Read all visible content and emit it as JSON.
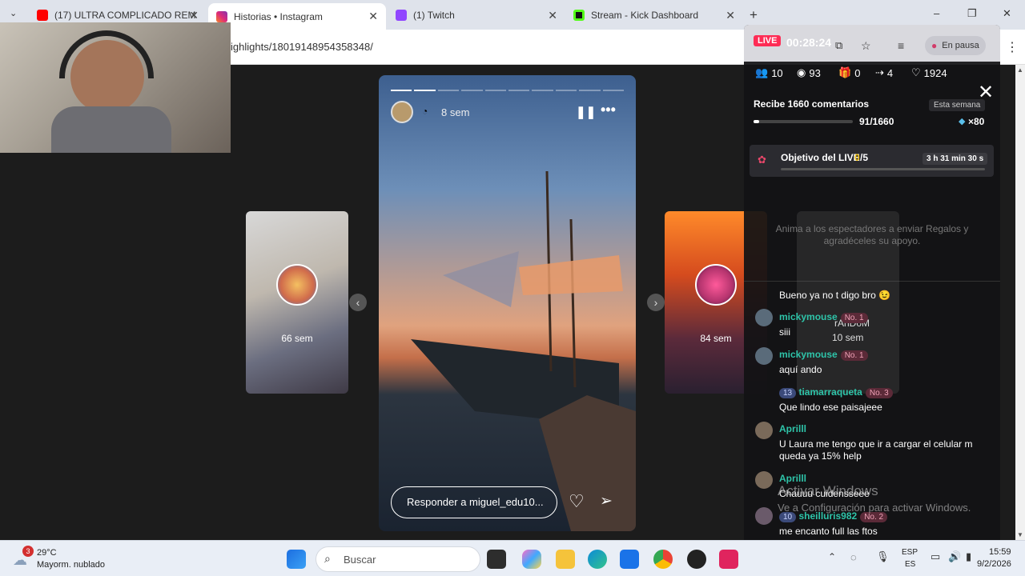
{
  "browser": {
    "tabs": [
      {
        "label": "(17) ULTRA COMPLICADO REM",
        "color": "#ff0000"
      },
      {
        "label": "Historias • Instagram",
        "color": "#e1306c"
      },
      {
        "label": "(1) Twitch",
        "color": "#9146ff"
      },
      {
        "label": "Stream - Kick Dashboard",
        "color": "#53fc18"
      }
    ],
    "new_tab": "+",
    "url": "ighlights/18019148954358348/",
    "window_controls": {
      "minimize": "–",
      "restore": "❐",
      "close": "✕"
    }
  },
  "story": {
    "time": "8 sem",
    "reply_placeholder": "Responder a miguel_edu10...",
    "left_preview_time": "66 sem",
    "right_preview_time": "84 sem",
    "segments_total": 10,
    "segments_done": 2
  },
  "panel": {
    "live_label": "LIVE",
    "timer": "00:28:24",
    "paused_label": "En pausa",
    "stats": {
      "viewers": "10",
      "views": "93",
      "gifts": "0",
      "shares": "4",
      "likes": "1924"
    },
    "goal_title": "Recibe 1660 comentarios",
    "goal_period": "Esta semana",
    "goal_progress": "91/1660",
    "goal_reward": "×80",
    "goal_fraction": 0.055,
    "objective_label": "Objetivo del LIVE",
    "objective_count": "0",
    "objective_total": "/5",
    "objective_timer": "3 h 31 min 30 s",
    "gift_prompt": "Anima a los espectadores a enviar Regalos y agradéceles su apoyo.",
    "ghost_user": "rAnDoM",
    "ghost_time": "10 sem",
    "messages": [
      {
        "user": "",
        "text": "Bueno ya no t digo bro 😉",
        "badge": ""
      },
      {
        "user": "mickymouse",
        "text": "siii",
        "badge": "No. 1"
      },
      {
        "user": "mickymouse",
        "text": "aquí ando",
        "badge": "No. 1"
      },
      {
        "user": "tiamarraqueta",
        "text": "Que lindo ese paisajeee",
        "badge": "No. 3",
        "level": "13"
      },
      {
        "user": "Aprilll",
        "text": "U Laura me tengo que ir a cargar el celular m queda ya 15% help",
        "badge": ""
      },
      {
        "user": "Aprilll",
        "text": "Chauuu cuidensseee",
        "badge": ""
      },
      {
        "user": "sheilluris982",
        "text": "me encanto full las ftos",
        "badge": "No. 2",
        "level": "10"
      }
    ]
  },
  "watermark": {
    "title": "Activar Windows",
    "subtitle": "Ve a Configuración para activar Windows."
  },
  "taskbar": {
    "weather_temp": "29°C",
    "weather_desc": "Mayorm. nublado",
    "weather_badge": "3",
    "search_label": "Buscar",
    "lang_top": "ESP",
    "lang_bottom": "ES",
    "time": "15:59",
    "date": "9/2/2026"
  }
}
